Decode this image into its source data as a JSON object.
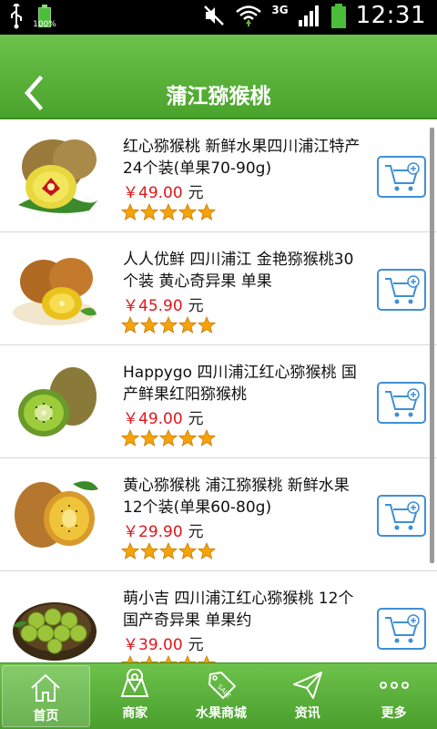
{
  "status_bar": {
    "battery_small_label": "100%",
    "network_label": "3G",
    "time": "12:31"
  },
  "header": {
    "title": "蒲江猕猴桃"
  },
  "colors": {
    "brand_green": "#56ad36",
    "price_red": "#e0161a",
    "cart_blue": "#3f8fd6",
    "star_orange": "#f6a20a"
  },
  "products": [
    {
      "title": "红心猕猴桃 新鲜水果四川浦江特产 24个装(单果70-90g)",
      "price": "￥49.00",
      "unit": "元",
      "rating": 5,
      "image": "red-heart-kiwi-image"
    },
    {
      "title": "人人优鲜 四川浦江 金艳猕猴桃30个装 黄心奇异果 单果",
      "price": "￥45.90",
      "unit": "元",
      "rating": 5,
      "image": "yellow-heart-kiwi-image"
    },
    {
      "title": "Happygo 四川浦江红心猕猴桃 国产鲜果红阳猕猴桃",
      "price": "￥49.00",
      "unit": "元",
      "rating": 5,
      "image": "green-kiwi-image"
    },
    {
      "title": "黄心猕猴桃 浦江猕猴桃 新鲜水果 12个装(单果60-80g)",
      "price": "￥29.90",
      "unit": "元",
      "rating": 5,
      "image": "golden-kiwi-image"
    },
    {
      "title": "萌小吉 四川浦江红心猕猴桃 12个 国产奇异果 单果约",
      "price": "￥39.00",
      "unit": "元",
      "rating": 5,
      "image": "kiwi-basket-image"
    }
  ],
  "bottom_nav": [
    {
      "label": "首页",
      "icon": "home-icon",
      "active": true
    },
    {
      "label": "商家",
      "icon": "map-pin-icon",
      "active": false
    },
    {
      "label": "水果商城",
      "icon": "sale-tag-icon",
      "active": false
    },
    {
      "label": "资讯",
      "icon": "paper-plane-icon",
      "active": false
    },
    {
      "label": "更多",
      "icon": "more-dots-icon",
      "active": false
    }
  ]
}
